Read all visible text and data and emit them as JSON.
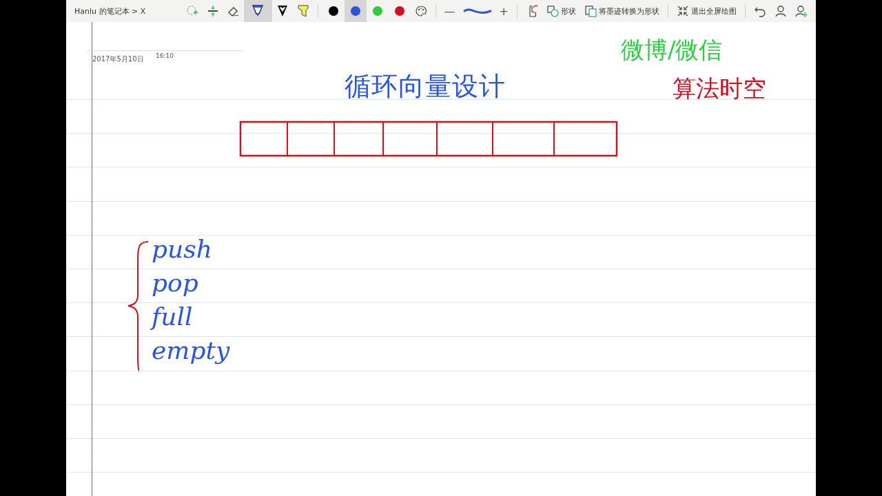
{
  "toolbar": {
    "breadcrumb": "Hanlu 的笔记本 > X",
    "tools": [
      {
        "kind": "lasso",
        "selected": false
      },
      {
        "kind": "space",
        "selected": false
      },
      {
        "kind": "eraser",
        "selected": false
      },
      {
        "kind": "pen",
        "selected": true
      },
      {
        "kind": "pencil",
        "selected": false
      },
      {
        "kind": "highlighter",
        "selected": false
      }
    ],
    "colors": [
      {
        "color": "#000000",
        "selected": false
      },
      {
        "color": "#2b56d9",
        "selected": true
      },
      {
        "color": "#2ecc40",
        "selected": false
      },
      {
        "color": "#d0101e",
        "selected": false
      }
    ],
    "stroke_minus": "—",
    "stroke_plus": "+",
    "actions": [
      {
        "kind": "shape",
        "label": "形状"
      },
      {
        "kind": "convert",
        "label": "将墨迹转换为形状"
      },
      {
        "kind": "exit",
        "label": "退出全屏绘图"
      }
    ]
  },
  "page": {
    "date": "2017年5月10日",
    "time": "16:10",
    "ink": [
      {
        "kind": "title",
        "text": "循环向量设计",
        "color": "#2b56d9"
      },
      {
        "kind": "note-green",
        "text": "微博/微信",
        "color": "#2ecc40"
      },
      {
        "kind": "note-red",
        "text": "算法时空",
        "color": "#d0101e"
      }
    ],
    "operations": [
      {
        "text": "push"
      },
      {
        "text": "pop"
      },
      {
        "text": "full"
      },
      {
        "text": "empty"
      }
    ]
  }
}
